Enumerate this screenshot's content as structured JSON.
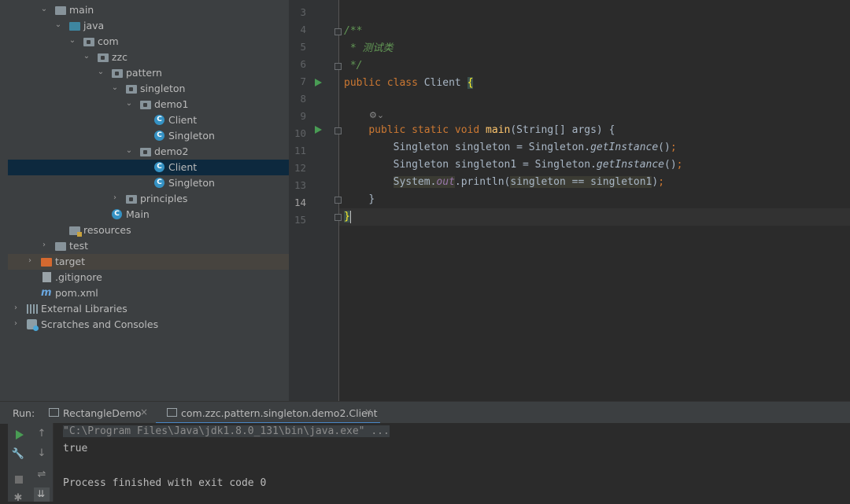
{
  "project_tree": {
    "items": [
      {
        "label": "main",
        "indent": 60,
        "arrow": "⌄",
        "icon": "folder"
      },
      {
        "label": "java",
        "indent": 78,
        "arrow": "⌄",
        "icon": "folder-blue"
      },
      {
        "label": "com",
        "indent": 96,
        "arrow": "⌄",
        "icon": "package"
      },
      {
        "label": "zzc",
        "indent": 114,
        "arrow": "⌄",
        "icon": "package"
      },
      {
        "label": "pattern",
        "indent": 132,
        "arrow": "⌄",
        "icon": "package"
      },
      {
        "label": "singleton",
        "indent": 150,
        "arrow": "⌄",
        "icon": "package"
      },
      {
        "label": "demo1",
        "indent": 168,
        "arrow": "⌄",
        "icon": "package"
      },
      {
        "label": "Client",
        "indent": 186,
        "arrow": "",
        "icon": "class"
      },
      {
        "label": "Singleton",
        "indent": 186,
        "arrow": "",
        "icon": "class"
      },
      {
        "label": "demo2",
        "indent": 168,
        "arrow": "⌄",
        "icon": "package"
      },
      {
        "label": "Client",
        "indent": 186,
        "arrow": "",
        "icon": "class",
        "selected": true
      },
      {
        "label": "Singleton",
        "indent": 186,
        "arrow": "",
        "icon": "class"
      },
      {
        "label": "principles",
        "indent": 150,
        "arrow": "›",
        "icon": "package"
      },
      {
        "label": "Main",
        "indent": 132,
        "arrow": "",
        "icon": "class"
      },
      {
        "label": "resources",
        "indent": 78,
        "arrow": "",
        "icon": "folder-res"
      },
      {
        "label": "test",
        "indent": 60,
        "arrow": "›",
        "icon": "folder"
      },
      {
        "label": "target",
        "indent": 42,
        "arrow": "›",
        "icon": "folder-orange",
        "excluded": true
      },
      {
        "label": ".gitignore",
        "indent": 42,
        "arrow": "",
        "icon": "file"
      },
      {
        "label": "pom.xml",
        "indent": 42,
        "arrow": "",
        "icon": "maven"
      },
      {
        "label": "External Libraries",
        "indent": 24,
        "arrow": "›",
        "icon": "library"
      },
      {
        "label": "Scratches and Consoles",
        "indent": 24,
        "arrow": "›",
        "icon": "scratch"
      }
    ]
  },
  "editor": {
    "line_numbers": [
      "3",
      "4",
      "5",
      "6",
      "7",
      "8",
      "9",
      "10",
      "11",
      "12",
      "13",
      "14",
      "15"
    ],
    "current_line": "14",
    "code": {
      "l4": "/**",
      "l5": " * 测试类",
      "l6": " */",
      "l7_kw1": "public",
      "l7_kw2": "class",
      "l7_name": "Client",
      "l7_brace": "{",
      "l9_kw1": "public",
      "l9_kw2": "static",
      "l9_kw3": "void",
      "l9_fn": "main",
      "l9_rest": "(String[] args) {",
      "l10_a": "Singleton singleton = Singleton.",
      "l10_fn": "getInstance",
      "l10_b": "()",
      "l10_semi": ";",
      "l11_a": "Singleton singleton1 = Singleton.",
      "l11_fn": "getInstance",
      "l11_b": "()",
      "l11_semi": ";",
      "l12_sys": "System.",
      "l12_out": "out",
      "l12_b": ".println(",
      "l12_arg": "singleton == singleton1",
      "l12_c": ")",
      "l12_semi": ";",
      "l13": "}",
      "l14": "}"
    }
  },
  "run_panel": {
    "title": "Run:",
    "tabs": [
      {
        "label": "RectangleDemo",
        "close": "×"
      },
      {
        "label": "com.zzc.pattern.singleton.demo2.Client",
        "close": "×"
      }
    ],
    "console": {
      "command": "\"C:\\Program Files\\Java\\jdk1.8.0_131\\bin\\java.exe\" ...",
      "output": "true",
      "exit": "Process finished with exit code 0"
    }
  },
  "colors": {
    "accent": "#4a88c7",
    "keyword": "#cc7832",
    "comment": "#629755",
    "function": "#ffc66d",
    "static_field": "#9876aa",
    "run_green": "#499c54"
  }
}
